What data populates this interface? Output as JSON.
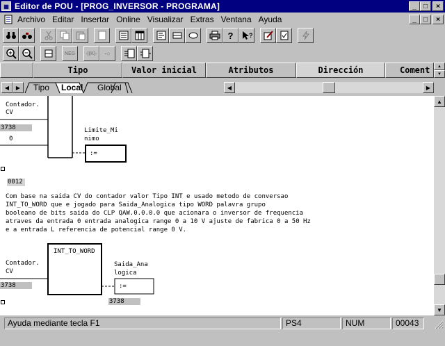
{
  "window": {
    "title": "Editor de POU - [PROG_INVERSOR - PROGRAMA]",
    "controls": [
      "_",
      "□",
      "×"
    ]
  },
  "menu": {
    "items": [
      {
        "label": "Archivo"
      },
      {
        "label": "Editar"
      },
      {
        "label": "Insertar"
      },
      {
        "label": "Online"
      },
      {
        "label": "Visualizar"
      },
      {
        "label": "Extras"
      },
      {
        "label": "Ventana"
      },
      {
        "label": "Ayuda"
      }
    ]
  },
  "toolbar2": {
    "neg_label": "NEG",
    "var_label": "-|(K)-",
    "rung_label": "-○"
  },
  "columns": [
    {
      "label": "Tipo"
    },
    {
      "label": "Valor inicial"
    },
    {
      "label": "Atributos"
    },
    {
      "label": "Dirección"
    },
    {
      "label": "Coment"
    }
  ],
  "tabs": [
    {
      "label": "Tipo"
    },
    {
      "label": "Local"
    },
    {
      "label": "Global"
    }
  ],
  "network1": {
    "input_label_1": "Contador.",
    "input_label_2": "CV",
    "input_value": "3738",
    "zero_value": "0",
    "output_label_1": "Limite_Mi",
    "output_label_2": "nimo",
    "assign": ":="
  },
  "network2": {
    "number": "0012",
    "comment": [
      "Com base na saida CV do contador valor Tipo INT e usado metodo de conversao",
      "INT_TO_WORD que e jogado para Saida_Analogica tipo WORD palavra grupo",
      "booleano de bits saida do CLP QAW.0.0.0.0 que acionara o inversor de frequencia",
      "atraves da entrada 0 entrada analogica range 0 a 10 V ajuste de fabrica 0 a 50 Hz",
      "e a entrada L referencia de potencial range 0 V."
    ],
    "block_name": "INT_TO_WORD",
    "input_label_1": "Contador.",
    "input_label_2": "CV",
    "input_value": "3738",
    "output_label_1": "Saida_Ana",
    "output_label_2": "logica",
    "assign": ":=",
    "output_value": "3738"
  },
  "status": {
    "help": "Ayuda mediante tecla F1",
    "mode": "PS4",
    "num": "NUM",
    "counter": "00043"
  },
  "colors": {
    "titlebar": "#000080",
    "face": "#c0c0c0",
    "canvas": "#ffffff"
  }
}
